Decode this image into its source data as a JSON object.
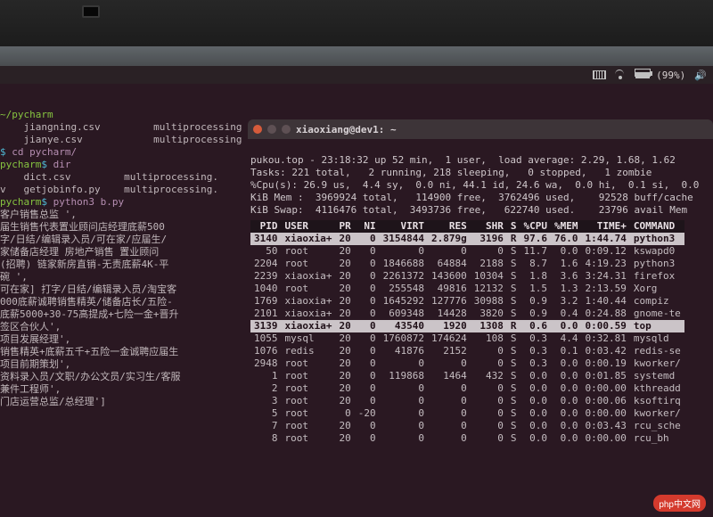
{
  "status": {
    "battery_pct": "(99%)"
  },
  "left_term": {
    "path_label": "~/pycharm",
    "lines": [
      "    jiangning.csv         multiprocessing",
      "    jianye.csv            multiprocessing",
      "$ cd pycharm/",
      "pycharm$ dir",
      "    dict.csv         multiprocessing.",
      "v   getjobinfo.py    multiprocessing.",
      "pycharm$ python3 b.py",
      "客户销售总监 ',",
      "届生销售代表置业顾问店经理底薪500",
      "字/日结/编辑录入员/可在家/应届生/",
      "家储备店经理 房地产销售 置业顾问",
      "(招聘) 链家新房直销-无责底薪4K-平",
      "碗 ',",
      "可在家] 打字/日结/编辑录入员/淘宝客",
      "000底薪诚聘销售精英/储备店长/五险-",
      "底薪5000+30-75高提成+七险一金+晋升",
      "签区合伙人',",
      "项目发展经理',",
      "销售精英+底薪五千+五险一金诚聘应届生",
      "项目前期策划',",
      "资料录入员/文职/办公文员/实习生/客服",
      "兼件工程师',",
      "门店运营总监/总经理']"
    ]
  },
  "right_term": {
    "title": "xiaoxiang@dev1: ~",
    "header": {
      "l1": "pukou.top - 23:18:32 up 52 min,  1 user,  load average: 2.29, 1.68, 1.62",
      "l2": "Tasks: 221 total,   2 running, 218 sleeping,   0 stopped,   1 zombie",
      "l3": "%Cpu(s): 26.9 us,  4.4 sy,  0.0 ni, 44.1 id, 24.6 wa,  0.0 hi,  0.1 si,  0.0",
      "l4": "KiB Mem :  3969924 total,   114900 free,  3762496 used,    92528 buff/cache",
      "l5": "KiB Swap:  4116476 total,  3493736 free,   622740 used.    23796 avail Mem"
    },
    "columns": [
      "PID",
      "USER",
      "PR",
      "NI",
      "VIRT",
      "RES",
      "SHR",
      "S",
      "%CPU",
      "%MEM",
      "TIME+",
      "COMMAND"
    ],
    "rows": [
      {
        "pid": "3140",
        "user": "xiaoxia+",
        "pr": "20",
        "ni": "0",
        "virt": "3154844",
        "res": "2.879g",
        "shr": "3196",
        "s": "R",
        "cpu": "97.6",
        "mem": "76.0",
        "time": "1:44.74",
        "cmd": "python3",
        "hl": true
      },
      {
        "pid": "50",
        "user": "root",
        "pr": "20",
        "ni": "0",
        "virt": "0",
        "res": "0",
        "shr": "0",
        "s": "S",
        "cpu": "11.7",
        "mem": "0.0",
        "time": "0:09.12",
        "cmd": "kswapd0"
      },
      {
        "pid": "2204",
        "user": "root",
        "pr": "20",
        "ni": "0",
        "virt": "1846688",
        "res": "64884",
        "shr": "2188",
        "s": "S",
        "cpu": "8.7",
        "mem": "1.6",
        "time": "4:19.23",
        "cmd": "python3"
      },
      {
        "pid": "2239",
        "user": "xiaoxia+",
        "pr": "20",
        "ni": "0",
        "virt": "2261372",
        "res": "143600",
        "shr": "10304",
        "s": "S",
        "cpu": "1.8",
        "mem": "3.6",
        "time": "3:24.31",
        "cmd": "firefox"
      },
      {
        "pid": "1040",
        "user": "root",
        "pr": "20",
        "ni": "0",
        "virt": "255548",
        "res": "49816",
        "shr": "12132",
        "s": "S",
        "cpu": "1.5",
        "mem": "1.3",
        "time": "2:13.59",
        "cmd": "Xorg"
      },
      {
        "pid": "1769",
        "user": "xiaoxia+",
        "pr": "20",
        "ni": "0",
        "virt": "1645292",
        "res": "127776",
        "shr": "30988",
        "s": "S",
        "cpu": "0.9",
        "mem": "3.2",
        "time": "1:40.44",
        "cmd": "compiz"
      },
      {
        "pid": "2101",
        "user": "xiaoxia+",
        "pr": "20",
        "ni": "0",
        "virt": "609348",
        "res": "14428",
        "shr": "3820",
        "s": "S",
        "cpu": "0.9",
        "mem": "0.4",
        "time": "0:24.88",
        "cmd": "gnome-te"
      },
      {
        "pid": "3139",
        "user": "xiaoxia+",
        "pr": "20",
        "ni": "0",
        "virt": "43540",
        "res": "1920",
        "shr": "1308",
        "s": "R",
        "cpu": "0.6",
        "mem": "0.0",
        "time": "0:00.59",
        "cmd": "top",
        "hl": true
      },
      {
        "pid": "1055",
        "user": "mysql",
        "pr": "20",
        "ni": "0",
        "virt": "1760872",
        "res": "174624",
        "shr": "108",
        "s": "S",
        "cpu": "0.3",
        "mem": "4.4",
        "time": "0:32.81",
        "cmd": "mysqld"
      },
      {
        "pid": "1076",
        "user": "redis",
        "pr": "20",
        "ni": "0",
        "virt": "41876",
        "res": "2152",
        "shr": "0",
        "s": "S",
        "cpu": "0.3",
        "mem": "0.1",
        "time": "0:03.42",
        "cmd": "redis-se"
      },
      {
        "pid": "2948",
        "user": "root",
        "pr": "20",
        "ni": "0",
        "virt": "0",
        "res": "0",
        "shr": "0",
        "s": "S",
        "cpu": "0.3",
        "mem": "0.0",
        "time": "0:00.19",
        "cmd": "kworker/"
      },
      {
        "pid": "1",
        "user": "root",
        "pr": "20",
        "ni": "0",
        "virt": "119868",
        "res": "1464",
        "shr": "432",
        "s": "S",
        "cpu": "0.0",
        "mem": "0.0",
        "time": "0:01.85",
        "cmd": "systemd"
      },
      {
        "pid": "2",
        "user": "root",
        "pr": "20",
        "ni": "0",
        "virt": "0",
        "res": "0",
        "shr": "0",
        "s": "S",
        "cpu": "0.0",
        "mem": "0.0",
        "time": "0:00.00",
        "cmd": "kthreadd"
      },
      {
        "pid": "3",
        "user": "root",
        "pr": "20",
        "ni": "0",
        "virt": "0",
        "res": "0",
        "shr": "0",
        "s": "S",
        "cpu": "0.0",
        "mem": "0.0",
        "time": "0:00.06",
        "cmd": "ksoftirq"
      },
      {
        "pid": "5",
        "user": "root",
        "pr": "0",
        "ni": "-20",
        "virt": "0",
        "res": "0",
        "shr": "0",
        "s": "S",
        "cpu": "0.0",
        "mem": "0.0",
        "time": "0:00.00",
        "cmd": "kworker/"
      },
      {
        "pid": "7",
        "user": "root",
        "pr": "20",
        "ni": "0",
        "virt": "0",
        "res": "0",
        "shr": "0",
        "s": "S",
        "cpu": "0.0",
        "mem": "0.0",
        "time": "0:03.43",
        "cmd": "rcu_sche"
      },
      {
        "pid": "8",
        "user": "root",
        "pr": "20",
        "ni": "0",
        "virt": "0",
        "res": "0",
        "shr": "0",
        "s": "S",
        "cpu": "0.0",
        "mem": "0.0",
        "time": "0:00.00",
        "cmd": "rcu_bh"
      }
    ]
  },
  "watermark": "php中文网"
}
